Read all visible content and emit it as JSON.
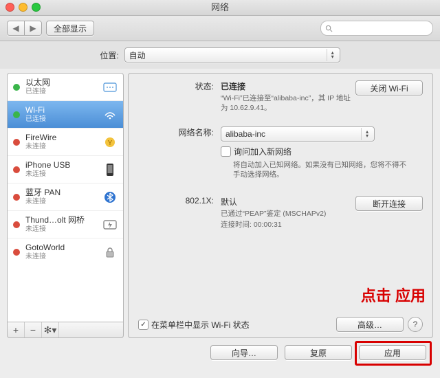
{
  "window": {
    "title": "网络"
  },
  "toolbar": {
    "back": "◀",
    "forward": "▶",
    "show_all": "全部显示",
    "search_placeholder": ""
  },
  "location": {
    "label": "位置:",
    "value": "自动"
  },
  "sidebar": {
    "items": [
      {
        "name": "以太网",
        "status": "已连接",
        "dot": "green",
        "icon": "ethernet"
      },
      {
        "name": "Wi-Fi",
        "status": "已连接",
        "dot": "green",
        "icon": "wifi",
        "selected": true
      },
      {
        "name": "FireWire",
        "status": "未连接",
        "dot": "red",
        "icon": "firewire"
      },
      {
        "name": "iPhone USB",
        "status": "未连接",
        "dot": "red",
        "icon": "iphone"
      },
      {
        "name": "蓝牙 PAN",
        "status": "未连接",
        "dot": "red",
        "icon": "bluetooth"
      },
      {
        "name": "Thund…olt 网桥",
        "status": "未连接",
        "dot": "red",
        "icon": "thunderbolt"
      },
      {
        "name": "GotoWorld",
        "status": "未连接",
        "dot": "red",
        "icon": "vpn"
      }
    ],
    "footer": {
      "add": "+",
      "remove": "−",
      "action": "✻▾"
    }
  },
  "detail": {
    "status_label": "状态:",
    "status_value": "已连接",
    "turnoff_btn": "关闭 Wi-Fi",
    "status_desc": "“Wi-Fi”已连接至“alibaba-inc”，其 IP 地址为 10.62.9.41。",
    "netname_label": "网络名称:",
    "netname_value": "alibaba-inc",
    "ask_join_label": "询问加入新网络",
    "ask_join_desc": "将自动加入已知网络。如果没有已知网络，您将不得不手动选择网络。",
    "dot1x_label": "802.1X:",
    "dot1x_value": "默认",
    "disconnect_btn": "断开连接",
    "dot1x_desc1": "已通过“PEAP”鉴定 (MSCHAPv2)",
    "dot1x_desc2": "连接时间: 00:00:31",
    "show_menubar": "在菜单栏中显示 Wi-Fi 状态",
    "advanced_btn": "高级…",
    "help": "?"
  },
  "buttons": {
    "assist": "向导…",
    "revert": "复原",
    "apply": "应用"
  },
  "annotation": {
    "text": "点击 应用"
  },
  "colors": {
    "accent": "#4b8ed6",
    "highlight_red": "#d80000"
  }
}
